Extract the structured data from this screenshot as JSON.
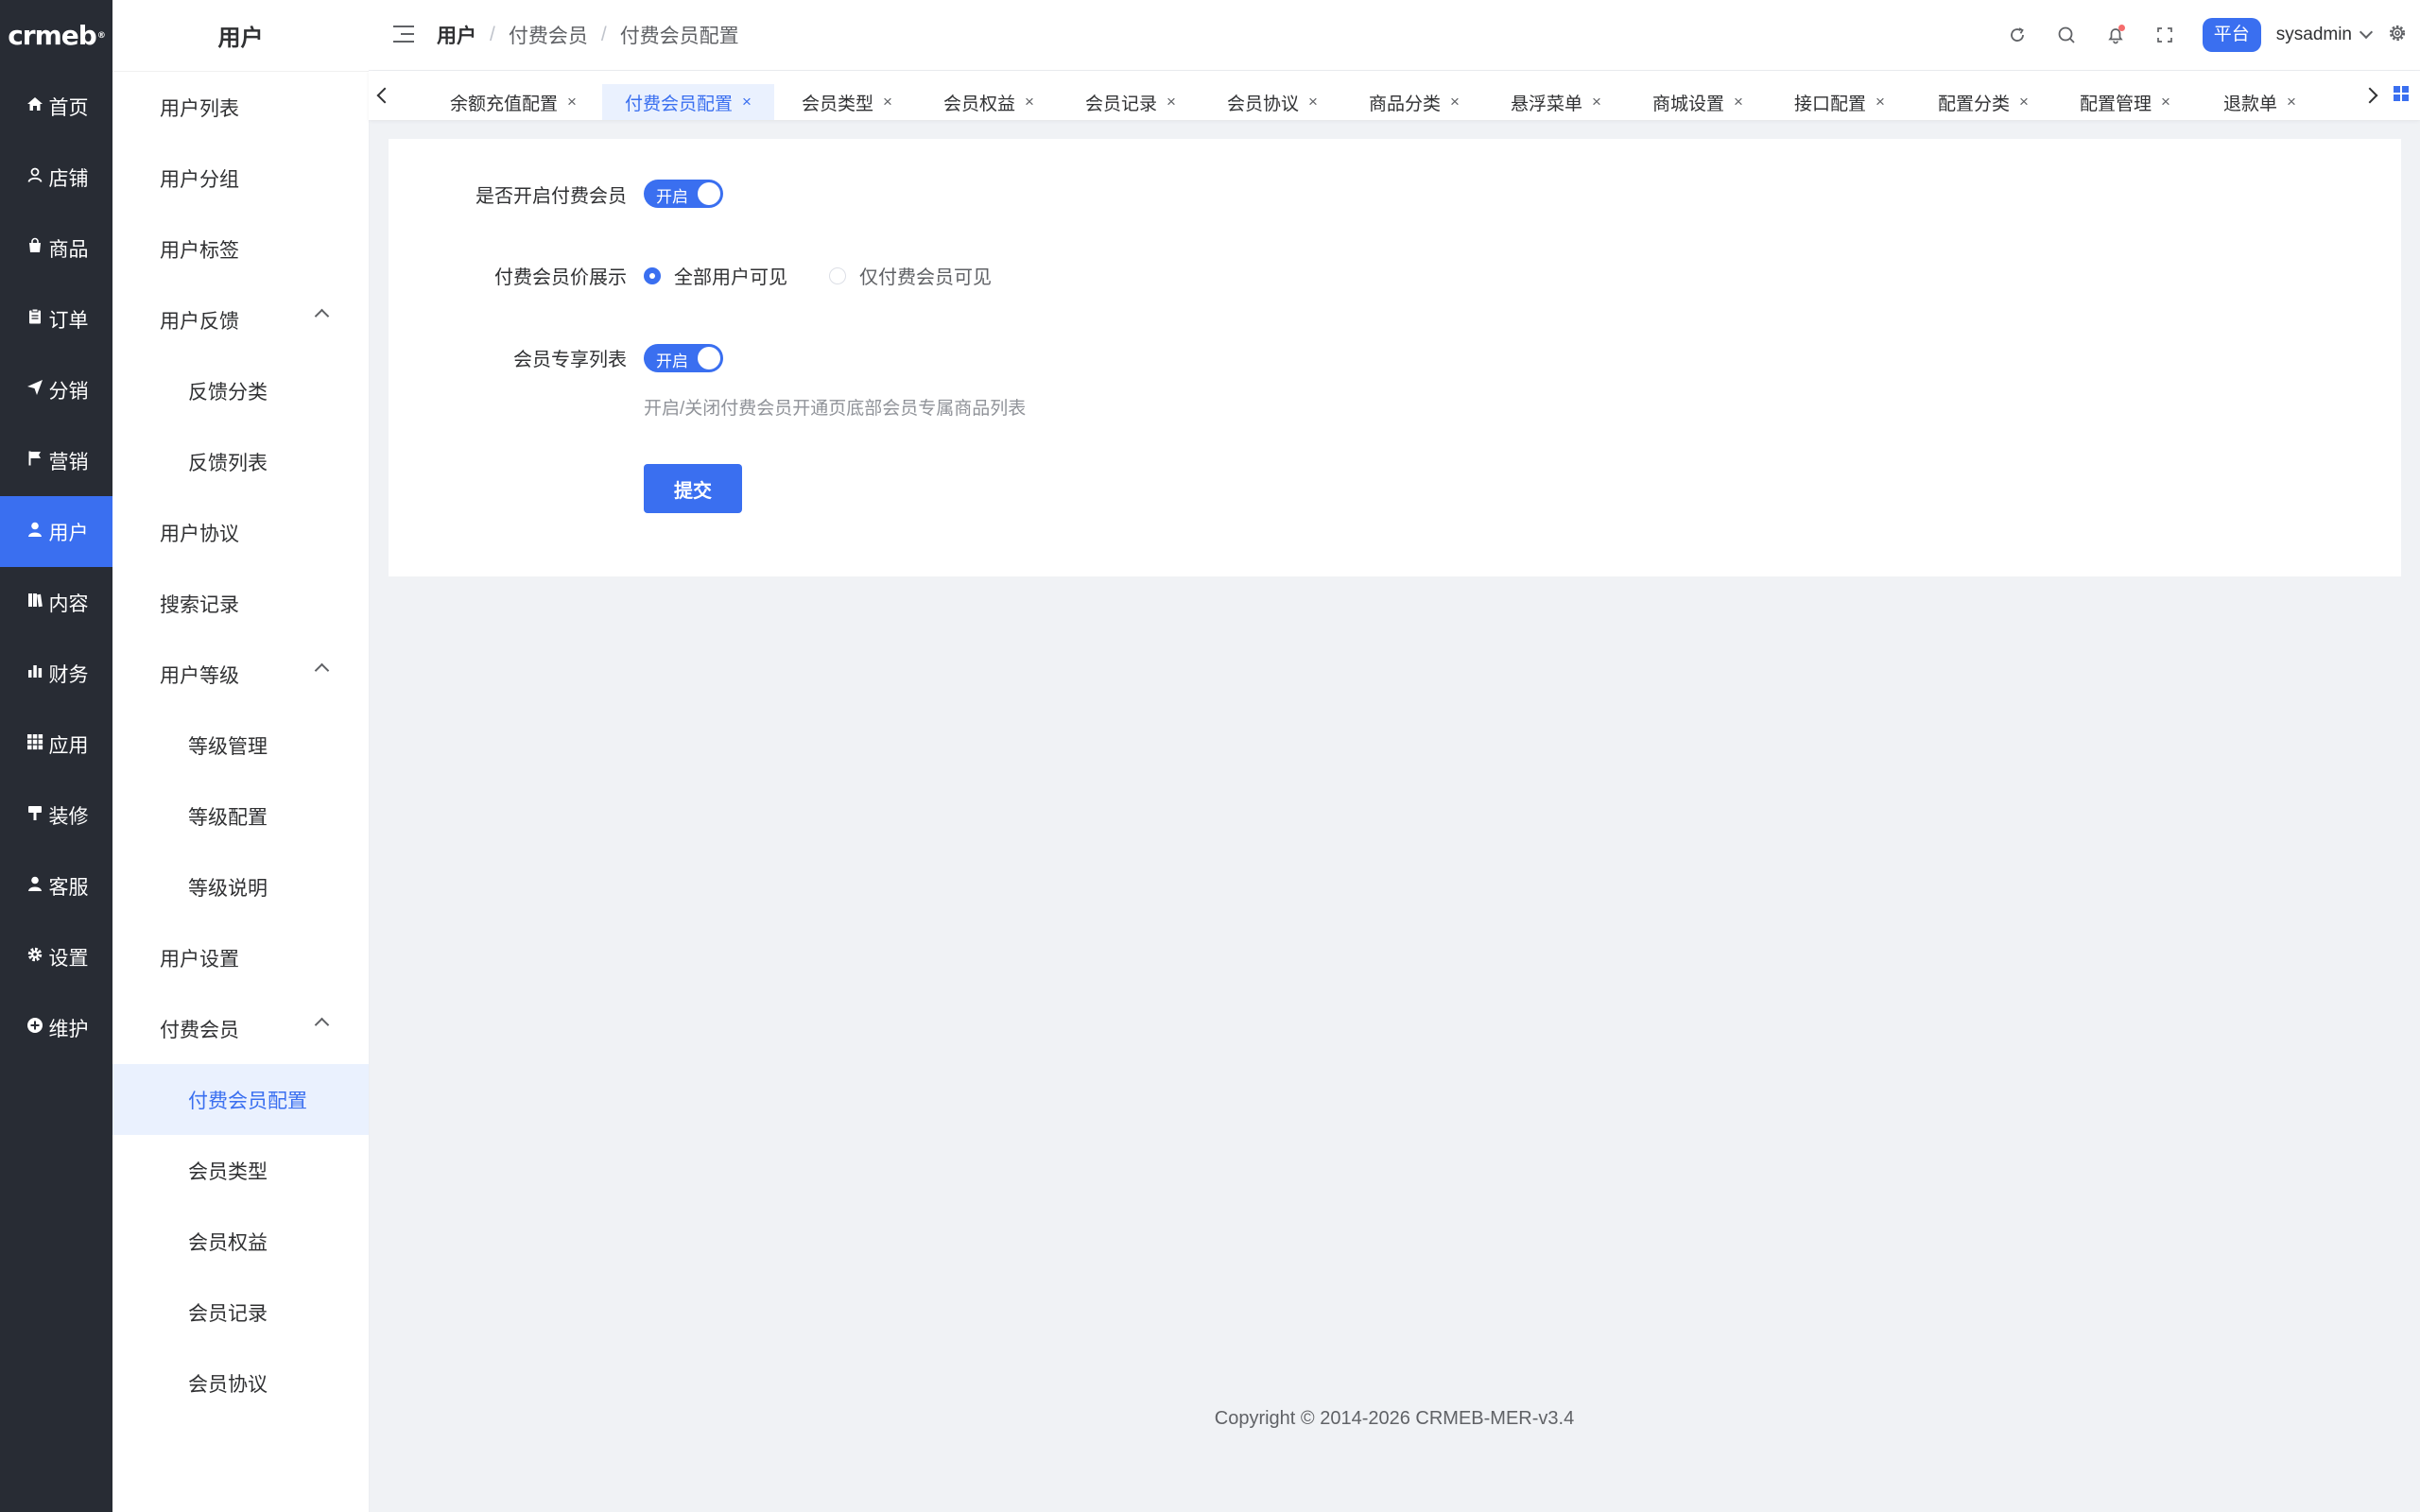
{
  "app": {
    "logo": "crmeb",
    "logo_mark": "®"
  },
  "nav": {
    "items": [
      {
        "label": "首页",
        "icon": "home-icon"
      },
      {
        "label": "店铺",
        "icon": "user-outline-icon"
      },
      {
        "label": "商品",
        "icon": "bag-icon"
      },
      {
        "label": "订单",
        "icon": "clipboard-icon"
      },
      {
        "label": "分销",
        "icon": "send-icon"
      },
      {
        "label": "营销",
        "icon": "flag-icon"
      },
      {
        "label": "用户",
        "icon": "user-icon"
      },
      {
        "label": "内容",
        "icon": "book-icon"
      },
      {
        "label": "财务",
        "icon": "bar-chart-icon"
      },
      {
        "label": "应用",
        "icon": "grid-icon"
      },
      {
        "label": "装修",
        "icon": "paint-icon"
      },
      {
        "label": "客服",
        "icon": "headset-icon"
      },
      {
        "label": "设置",
        "icon": "gear-icon"
      },
      {
        "label": "维护",
        "icon": "plus-circle-icon"
      }
    ],
    "active": "用户"
  },
  "submenu": {
    "title": "用户",
    "items": [
      {
        "label": "用户列表",
        "level": 1
      },
      {
        "label": "用户分组",
        "level": 1
      },
      {
        "label": "用户标签",
        "level": 1
      },
      {
        "label": "用户反馈",
        "level": 1,
        "expanded": true
      },
      {
        "label": "反馈分类",
        "level": 2
      },
      {
        "label": "反馈列表",
        "level": 2
      },
      {
        "label": "用户协议",
        "level": 1
      },
      {
        "label": "搜索记录",
        "level": 1
      },
      {
        "label": "用户等级",
        "level": 1,
        "expanded": true
      },
      {
        "label": "等级管理",
        "level": 2
      },
      {
        "label": "等级配置",
        "level": 2
      },
      {
        "label": "等级说明",
        "level": 2
      },
      {
        "label": "用户设置",
        "level": 1
      },
      {
        "label": "付费会员",
        "level": 1,
        "expanded": true
      },
      {
        "label": "付费会员配置",
        "level": 2,
        "active": true
      },
      {
        "label": "会员类型",
        "level": 2
      },
      {
        "label": "会员权益",
        "level": 2
      },
      {
        "label": "会员记录",
        "level": 2
      },
      {
        "label": "会员协议",
        "level": 2
      }
    ]
  },
  "header": {
    "breadcrumb": [
      "用户",
      "付费会员",
      "付费会员配置"
    ],
    "platform_label": "平台",
    "username": "sysadmin",
    "icons": [
      "refresh-icon",
      "search-icon",
      "bell-icon",
      "fullscreen-icon",
      "gear-icon"
    ]
  },
  "tabs": {
    "items": [
      "余额充值配置",
      "付费会员配置",
      "会员类型",
      "会员权益",
      "会员记录",
      "会员协议",
      "商品分类",
      "悬浮菜单",
      "商城设置",
      "接口配置",
      "配置分类",
      "配置管理",
      "退款单"
    ],
    "active": "付费会员配置",
    "close_glyph": "×"
  },
  "form": {
    "enable_label": "是否开启付费会员",
    "enable_switch": "开启",
    "price_label": "付费会员价展示",
    "price_options": [
      {
        "label": "全部用户可见",
        "selected": true
      },
      {
        "label": "仅付费会员可见",
        "selected": false
      }
    ],
    "exclusive_label": "会员专享列表",
    "exclusive_switch": "开启",
    "exclusive_hint": "开启/关闭付费会员开通页底部会员专属商品列表",
    "submit": "提交"
  },
  "footer": {
    "copyright": "Copyright © 2014-2026 CRMEB-MER-v3.4"
  },
  "colors": {
    "accent": "#3a6ff0",
    "nav_bg": "#282c34",
    "page_bg": "#f0f2f5"
  }
}
